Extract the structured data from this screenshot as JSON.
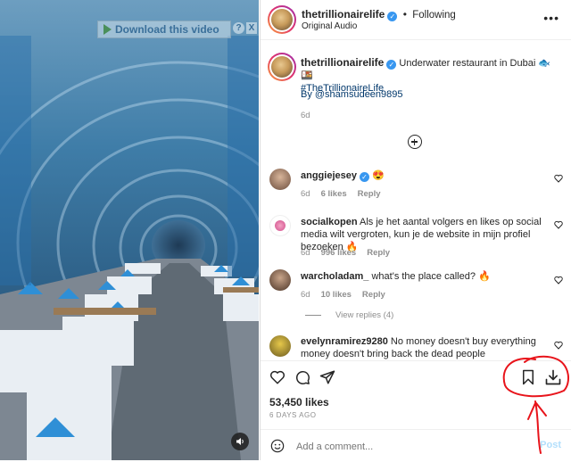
{
  "video": {
    "download_banner": "Download this video",
    "help_glyph": "?",
    "close_glyph": "X"
  },
  "header": {
    "username": "thetrillionairelife",
    "separator": "•",
    "follow_status": "Following",
    "audio": "Original Audio"
  },
  "caption": {
    "username": "thetrillionairelife",
    "text": "Underwater restaurant in Dubai 🐟🍱",
    "hashtag": "#TheTrillionaireLife",
    "credit": "By @shamsudeen9895",
    "age": "6d"
  },
  "comments": [
    {
      "username": "anggiejesey",
      "verified": true,
      "text": "😍",
      "age": "6d",
      "likes": "6 likes",
      "reply": "Reply"
    },
    {
      "username": "socialkopen",
      "verified": false,
      "text": "Als je het aantal volgers en likes op social media wilt vergroten, kun je de website in mijn profiel bezoeken 🔥",
      "age": "6d",
      "likes": "996 likes",
      "reply": "Reply"
    },
    {
      "username": "warcholadam_",
      "verified": false,
      "text": "what's the place called? 🔥",
      "age": "6d",
      "likes": "10 likes",
      "reply": "Reply",
      "view_replies": "View replies (4)"
    },
    {
      "username": "evelynramirez9280",
      "verified": false,
      "text": "No money doesn't buy everything money doesn't bring back the dead people",
      "age": "",
      "likes": "",
      "reply": ""
    }
  ],
  "actions": {
    "likes": "53,450 likes",
    "posted": "6 DAYS AGO",
    "comment_placeholder": "Add a comment...",
    "post_label": "Post"
  },
  "colors": {
    "verified": "#3897f0",
    "link": "#00376b",
    "annotation": "#e8141b",
    "post_disabled": "#b2dffc"
  }
}
